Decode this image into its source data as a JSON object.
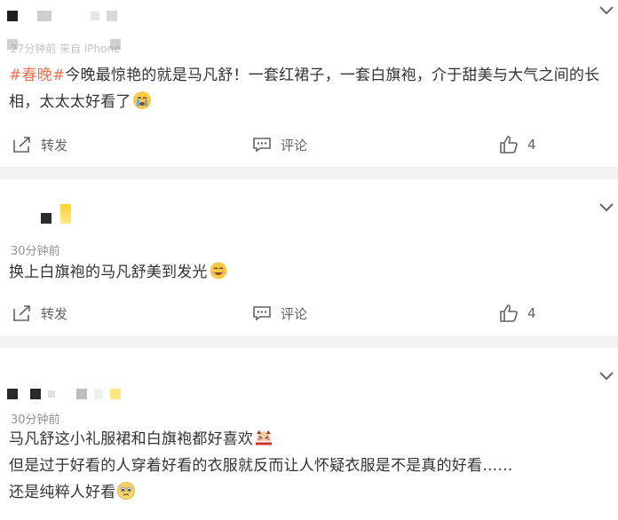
{
  "posts": [
    {
      "time": "27分钟前 来自 iPhone",
      "topic": "#春晚#",
      "text_line1": "今晚最惊艳的就是马凡舒！一套红裙子，一套白旗袍，介于甜美与大气之间的长",
      "text_line2": "相，太太太好看了",
      "emoji": "crying-face",
      "actions": {
        "repost": "转发",
        "comment": "评论",
        "like": "4"
      }
    },
    {
      "time": "30分钟前",
      "text_line1": "换上白旗袍的马凡舒美到发光",
      "emoji": "smiling-face",
      "actions": {
        "repost": "转发",
        "comment": "评论",
        "like": "4"
      }
    },
    {
      "time": "30分钟前",
      "text_line1": "马凡舒这小礼服裙和白旗袍都好喜欢",
      "text_line2": "但是过于好看的人穿着好看的衣服就反而让人怀疑衣服是不是真的好看……",
      "text_line3": "还是纯粹人好看",
      "emojis": [
        "shy-face",
        "pleading-face"
      ]
    }
  ],
  "colors": {
    "topic": "#eb7350",
    "meta": "#939393",
    "separator": "#f2f2f2",
    "action": "#636363"
  }
}
